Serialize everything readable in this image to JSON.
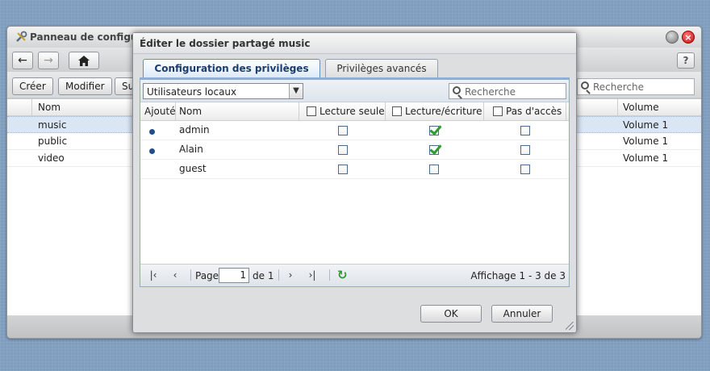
{
  "background_window": {
    "title": "Panneau de configu",
    "toolbar": {
      "back_icon": "arrow-left-icon",
      "forward_icon": "arrow-right-icon",
      "home_icon": "home-icon",
      "help_label": "?",
      "buttons": [
        "Créer",
        "Modifier",
        "Su"
      ],
      "search_placeholder": "Recherche"
    },
    "grid": {
      "columns": [
        "Nom",
        "Volume"
      ],
      "rows": [
        {
          "name": "music",
          "volume": "Volume 1",
          "selected": true
        },
        {
          "name": "public",
          "volume": "Volume 1",
          "selected": false
        },
        {
          "name": "video",
          "volume": "Volume 1",
          "selected": false
        }
      ]
    }
  },
  "dialog": {
    "title": "Éditer le dossier partagé music",
    "tabs": [
      {
        "label": "Configuration des privilèges",
        "active": true
      },
      {
        "label": "Privilèges avancés",
        "active": false
      }
    ],
    "user_filter": {
      "selected": "Utilisateurs locaux"
    },
    "search_placeholder": "Recherche",
    "columns": {
      "added": "Ajouté",
      "name": "Nom",
      "read_only": "Lecture seule",
      "read_write": "Lecture/écriture",
      "no_access": "Pas d'accès"
    },
    "users": [
      {
        "added": true,
        "name": "admin",
        "read_only": false,
        "read_write": true,
        "no_access": false
      },
      {
        "added": true,
        "name": "Alain",
        "read_only": false,
        "read_write": true,
        "no_access": false
      },
      {
        "added": false,
        "name": "guest",
        "read_only": false,
        "read_write": false,
        "no_access": false
      }
    ],
    "pager": {
      "page_label": "Page",
      "page_value": "1",
      "of_label": "de 1",
      "summary": "Affichage 1 - 3 de 3"
    },
    "buttons": {
      "ok": "OK",
      "cancel": "Annuler"
    }
  },
  "colors": {
    "desktop": "#7f9ebf",
    "selection": "#dbe6f4",
    "accent": "#1a3d6e",
    "check": "#2d9b2d"
  }
}
